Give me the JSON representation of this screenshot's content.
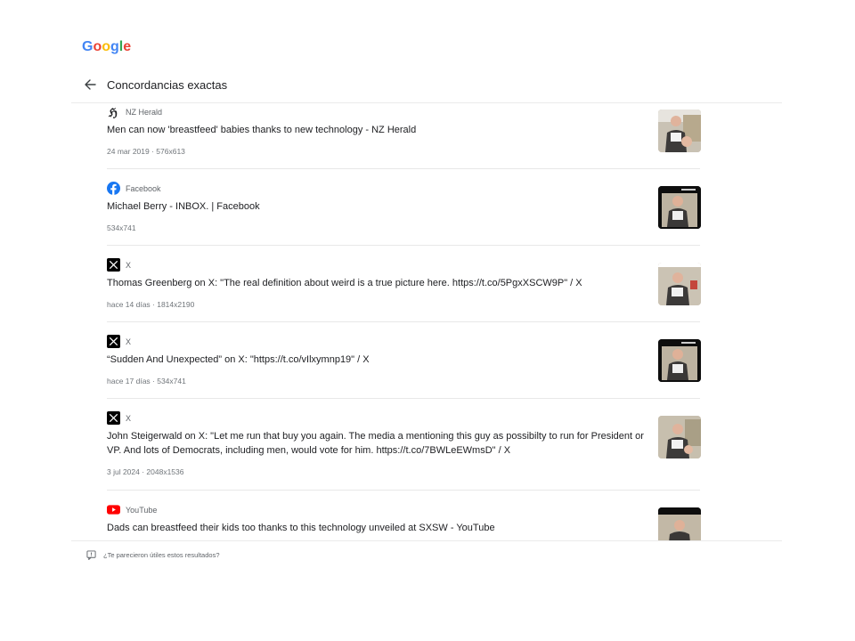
{
  "logo": {
    "letters": [
      {
        "ch": "G",
        "color": "#4285F4"
      },
      {
        "ch": "o",
        "color": "#EA4335"
      },
      {
        "ch": "o",
        "color": "#FBBC05"
      },
      {
        "ch": "g",
        "color": "#4285F4"
      },
      {
        "ch": "l",
        "color": "#34A853"
      },
      {
        "ch": "e",
        "color": "#EA4335"
      }
    ]
  },
  "header": {
    "title": "Concordancias exactas"
  },
  "results": [
    {
      "source": "NZ Herald",
      "icon": "nz-herald-icon",
      "title": "Men can now 'breastfeed' babies thanks to new technology - NZ Herald",
      "meta": "24 mar 2019 · 576x613"
    },
    {
      "source": "Facebook",
      "icon": "facebook-icon",
      "title": "Michael Berry - INBOX. | Facebook",
      "meta": "534x741"
    },
    {
      "source": "X",
      "icon": "x-icon",
      "title": "Thomas Greenberg on X: \"The real definition about weird is a true picture here. https://t.co/5PgxXSCW9P\" / X",
      "meta": "hace 14 días · 1814x2190"
    },
    {
      "source": "X",
      "icon": "x-icon",
      "title": "“Sudden And Unexpected” on X: \"https://t.co/vIlxymnp19\" / X",
      "meta": "hace 17 días · 534x741"
    },
    {
      "source": "X",
      "icon": "x-icon",
      "title": "John Steigerwald on X: \"Let me run that buy you again. The media a mentioning this guy as possibilty to run for President or VP. And lots of Democrats, including men, would vote for him. https://t.co/7BWLeEWmsD\" / X",
      "meta": "3 jul 2024 · 2048x1536"
    },
    {
      "source": "YouTube",
      "icon": "youtube-icon",
      "title": "Dads can breastfeed their kids too thanks to this technology unveiled at SXSW - YouTube",
      "meta": ""
    }
  ],
  "feedback": {
    "label": "¿Te parecieron útiles estos resultados?"
  }
}
